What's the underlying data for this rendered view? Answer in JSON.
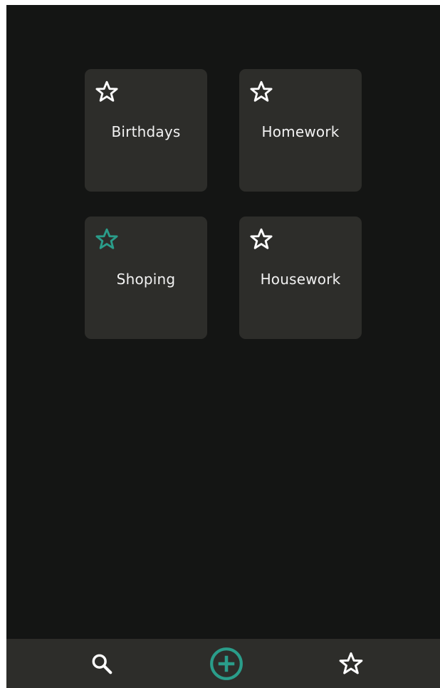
{
  "colors": {
    "background": "#141514",
    "card": "#2d2d2a",
    "accent": "#2a9d8a",
    "icon": "#ffffff",
    "text": "#f2f2f2"
  },
  "categories": [
    {
      "label": "Birthdays",
      "favorite": false,
      "icon": "star-outline-icon"
    },
    {
      "label": "Homework",
      "favorite": false,
      "icon": "star-outline-icon"
    },
    {
      "label": "Shoping",
      "favorite": true,
      "icon": "star-outline-icon"
    },
    {
      "label": "Housework",
      "favorite": false,
      "icon": "star-outline-icon"
    }
  ],
  "bottom_nav": {
    "items": [
      {
        "icon": "search-icon"
      },
      {
        "icon": "add-circle-icon"
      },
      {
        "icon": "star-outline-icon"
      }
    ]
  }
}
